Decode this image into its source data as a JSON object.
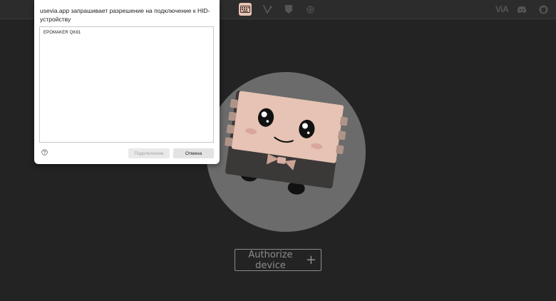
{
  "topbar": {
    "icons": [
      "keyboard-icon",
      "design-icon",
      "debug-icon",
      "settings-icon"
    ],
    "active_icon": "keyboard-icon",
    "right_icons": [
      "via-logo",
      "discord-icon",
      "github-icon"
    ],
    "via_text": "ViA"
  },
  "dialog": {
    "title": "usevia.app запрашивает разрешение на подключение к HID-устройству",
    "devices": [
      "EPOMAKER QK81"
    ],
    "connect_label": "Подключение",
    "cancel_label": "Отмена"
  },
  "main": {
    "authorize_label": "Authorize device"
  },
  "colors": {
    "background": "#232323",
    "accent": "#e8c4b4",
    "circle": "#6b6b6b",
    "mascot_face": "#e6c3b4",
    "mascot_body": "#3b3838"
  }
}
